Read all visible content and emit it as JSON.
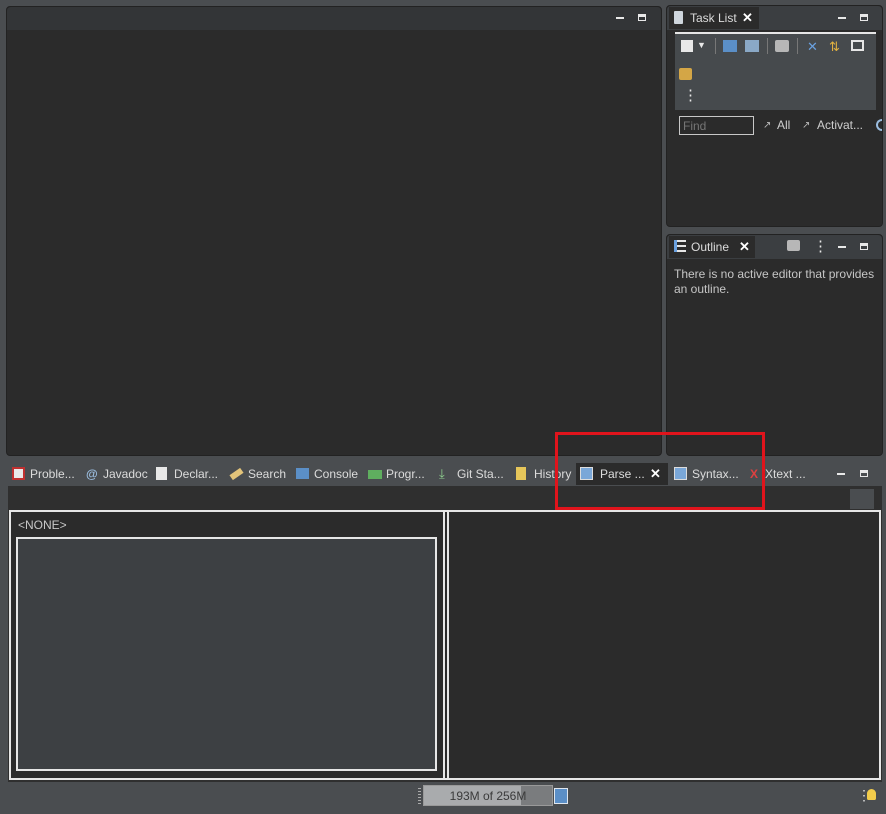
{
  "editor": {},
  "task_list": {
    "tab_label": "Task List",
    "find_placeholder": "Find",
    "filter_all": "All",
    "filter_activate": "Activat..."
  },
  "outline": {
    "tab_label": "Outline",
    "message": "There is no active editor that provides an outline."
  },
  "bottom_tabs": [
    {
      "label": "Proble..."
    },
    {
      "label": "Javadoc"
    },
    {
      "label": "Declar..."
    },
    {
      "label": "Search"
    },
    {
      "label": "Console"
    },
    {
      "label": "Progr..."
    },
    {
      "label": "Git Sta..."
    },
    {
      "label": "History"
    },
    {
      "label": "Parse ..."
    },
    {
      "label": "Syntax..."
    },
    {
      "label": "Xtext ..."
    }
  ],
  "parse_view": {
    "selector_value": "<NONE>"
  },
  "status_bar": {
    "heap_label": "193M of 256M",
    "heap_used_fraction": 0.754
  },
  "colors": {
    "highlight_box": "#e0141c",
    "panel_bg": "#2b2b2b",
    "frame_bg": "#4a4d50"
  }
}
